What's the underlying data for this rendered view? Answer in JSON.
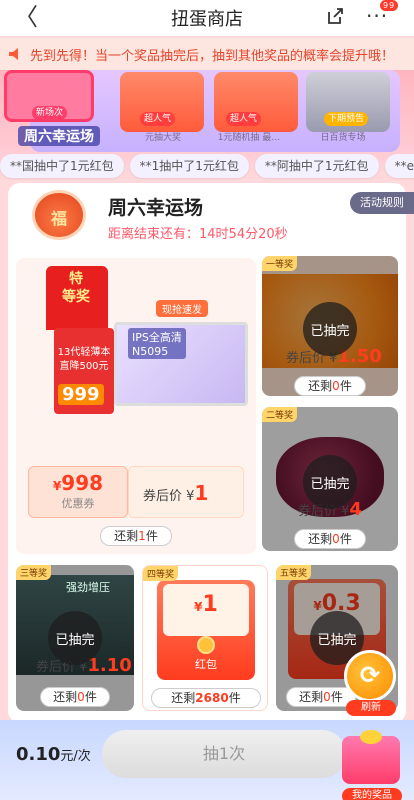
{
  "nav": {
    "back_glyph": "〈",
    "title": "扭蛋商店",
    "more_glyph": "···",
    "more_badge": "99"
  },
  "notice": {
    "text": "先到先得！当一个奖品抽完后，抽到其他奖品的概率会提升哦！"
  },
  "hero": {
    "lucky_label": "周六幸运场",
    "items": [
      {
        "tag": "新场次",
        "caption": ""
      },
      {
        "tag": "超人气",
        "caption": "元抽大奖"
      },
      {
        "tag": "超人气",
        "caption": "1元随机抽 最…"
      },
      {
        "tag": "下期预告",
        "caption": "日百货专场"
      }
    ]
  },
  "ticker": [
    "**国抽中了1元红包",
    "**1抽中了1元红包",
    "**阿抽中了1元红包",
    "**e抽中了1元红"
  ],
  "panel": {
    "fu": "福",
    "title": "周六幸运场",
    "countdown_label": "距离结束还有：",
    "countdown": "14时54分20秒",
    "rules": "活动规则"
  },
  "grand": {
    "flag": "特\n等奖",
    "promo_title": "13代轻薄本",
    "promo_sub": "直降500元",
    "promo_price": "999",
    "quick": "现抢速发",
    "laptop_label": "IPS全高清",
    "laptop_model": "N5095",
    "coupon_amount": "998",
    "coupon_currency": "¥",
    "coupon_label": "优惠券",
    "after_label": "券后价 ¥",
    "after_price": "1",
    "remain_label": "还剩",
    "remain_num": "1",
    "remain_unit": "件"
  },
  "prizes": [
    {
      "grade": "一等奖",
      "status": "已抽完",
      "after_label": "券后价 ¥",
      "after_price": "1.50",
      "remain_label": "还剩",
      "remain_num": "0",
      "remain_unit": "件"
    },
    {
      "grade": "二等奖",
      "status": "已抽完",
      "after_label": "券后价 ¥",
      "after_price": "4",
      "remain_label": "还剩",
      "remain_num": "0",
      "remain_unit": "件"
    },
    {
      "grade": "三等奖",
      "status": "已抽完",
      "after_label": "券后价 ¥",
      "after_price": "1.10",
      "remain_label": "还剩",
      "remain_num": "0",
      "remain_unit": "件",
      "img_text": "强劲增压"
    },
    {
      "grade": "四等奖",
      "amount": "1",
      "currency": "¥",
      "label": "红包",
      "remain_label": "还剩",
      "remain_num": "2680",
      "remain_unit": "件"
    },
    {
      "grade": "五等奖",
      "status": "已抽完",
      "amount": "0.3",
      "currency": "¥",
      "remain_label": "还剩",
      "remain_num": "0",
      "remain_unit": "件"
    }
  ],
  "refresh": {
    "glyph": "⟳",
    "label": "刷新"
  },
  "bottom": {
    "price_num": "0.10",
    "price_unit": "元/次",
    "draw_label": "抽1次",
    "my_prize": "我的奖品"
  },
  "colors": {
    "accent": "#ff3c1f",
    "notice_text": "#e6442a",
    "countdown": "#ff5a6a"
  }
}
